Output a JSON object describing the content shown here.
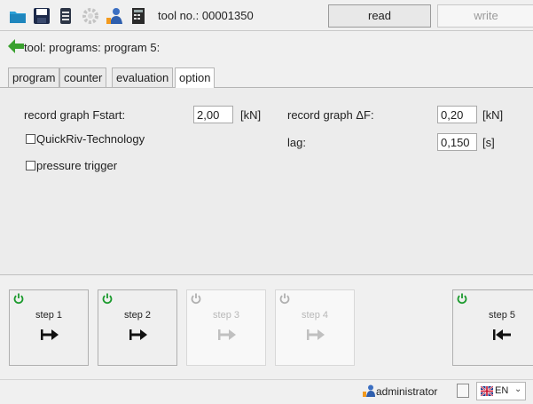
{
  "toolbar": {
    "tool_no": "tool no.: 00001350",
    "read_label": "read",
    "write_label": "write",
    "icons": [
      "open-folder-icon",
      "save-icon",
      "print-icon",
      "gear-icon",
      "user-icon",
      "device-icon"
    ]
  },
  "breadcrumb": {
    "text": "tool: programs: program 5:",
    "icon": "back-arrow-icon"
  },
  "tabs": [
    {
      "label": "program"
    },
    {
      "label": "counter"
    },
    {
      "label": "evaluation"
    },
    {
      "label": "option",
      "active": true
    }
  ],
  "option": {
    "fstart_label": "record graph Fstart:",
    "fstart_value": "2,00",
    "fstart_unit": "[kN]",
    "deltaf_label": "record graph ΔF:",
    "deltaf_value": "0,20",
    "deltaf_unit": "[kN]",
    "lag_label": "lag:",
    "lag_value": "0,150",
    "lag_unit": "[s]",
    "quickriv_label": "QuickRiv-Technology",
    "quickriv_checked": false,
    "pressure_label": "pressure trigger",
    "pressure_checked": false
  },
  "steps": [
    {
      "label": "step 1",
      "enabled": true,
      "direction": "forward"
    },
    {
      "label": "step 2",
      "enabled": true,
      "direction": "forward"
    },
    {
      "label": "step 3",
      "enabled": false,
      "direction": "forward"
    },
    {
      "label": "step 4",
      "enabled": false,
      "direction": "forward"
    },
    {
      "label": "step 5",
      "enabled": true,
      "direction": "back"
    }
  ],
  "status": {
    "user": "administrator",
    "language": "EN"
  },
  "colors": {
    "power_on": "#1a9a2c",
    "power_off": "#b0b0b0",
    "back_arrow": "#3aa12f",
    "folder": "#2a9fd6"
  }
}
